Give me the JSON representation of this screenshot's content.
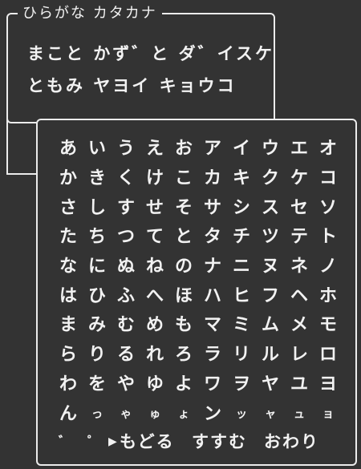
{
  "name_window": {
    "title": "ひらがな カタカナ",
    "rows": [
      "まこと かず゛と ダ゛イスケ",
      "ともみ ヤヨイ キョウコ"
    ]
  },
  "keyboard": {
    "rows": [
      [
        "あ",
        "い",
        "う",
        "え",
        "お",
        "ア",
        "イ",
        "ウ",
        "エ",
        "オ"
      ],
      [
        "か",
        "き",
        "く",
        "け",
        "こ",
        "カ",
        "キ",
        "ク",
        "ケ",
        "コ"
      ],
      [
        "さ",
        "し",
        "す",
        "せ",
        "そ",
        "サ",
        "シ",
        "ス",
        "セ",
        "ソ"
      ],
      [
        "た",
        "ち",
        "つ",
        "て",
        "と",
        "タ",
        "チ",
        "ツ",
        "テ",
        "ト"
      ],
      [
        "な",
        "に",
        "ぬ",
        "ね",
        "の",
        "ナ",
        "ニ",
        "ヌ",
        "ネ",
        "ノ"
      ],
      [
        "は",
        "ひ",
        "ふ",
        "へ",
        "ほ",
        "ハ",
        "ヒ",
        "フ",
        "ヘ",
        "ホ"
      ],
      [
        "ま",
        "み",
        "む",
        "め",
        "も",
        "マ",
        "ミ",
        "ム",
        "メ",
        "モ"
      ],
      [
        "ら",
        "り",
        "る",
        "れ",
        "ろ",
        "ラ",
        "リ",
        "ル",
        "レ",
        "ロ"
      ],
      [
        "わ",
        "を",
        "や",
        "ゆ",
        "よ",
        "ワ",
        "ヲ",
        "ヤ",
        "ユ",
        "ヨ"
      ],
      [
        "ん",
        "っ",
        "ゃ",
        "ゅ",
        "ょ",
        "ン",
        "ッ",
        "ャ",
        "ュ",
        "ョ"
      ]
    ],
    "bottom": {
      "dakuten": "゛",
      "handakuten": "゜",
      "cursor": "▶",
      "back": "もどる",
      "space": "すすむ",
      "end": "おわり"
    }
  },
  "colors": {
    "background": "#333333",
    "text": "#f2f2f2",
    "border": "#ececec"
  }
}
